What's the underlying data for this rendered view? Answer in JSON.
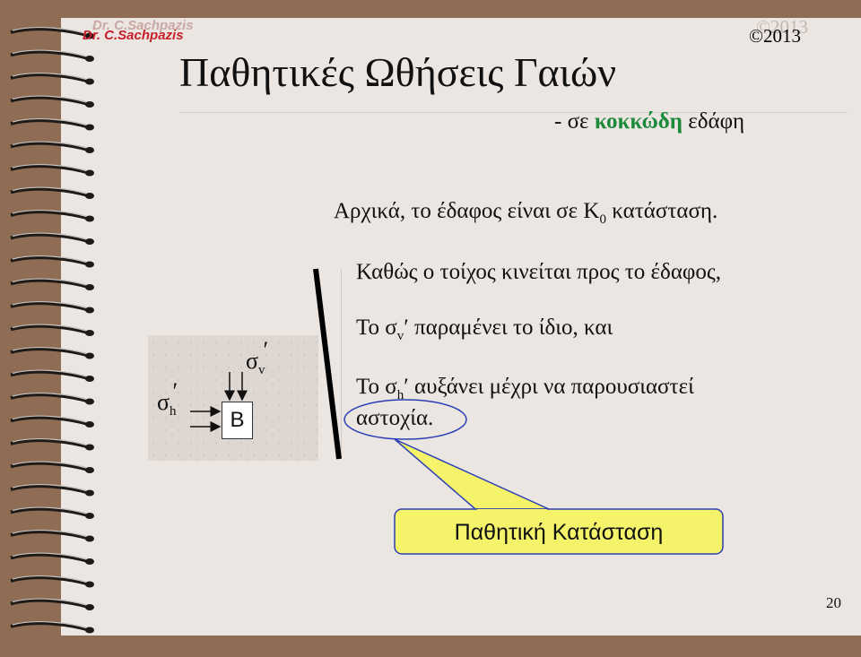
{
  "header": {
    "author": "Dr. C.Sachpazis",
    "copyright": "©2013",
    "title": "Παθητικές Ωθήσεις Γαιών",
    "subtitle_prefix": "- σε ",
    "subtitle_highlight": "κοκκώδη",
    "subtitle_suffix": " εδάφη"
  },
  "body": {
    "line1_prefix": "Αρχικά, το έδαφος είναι σε K",
    "line1_sub": "0",
    "line1_suffix": " κατάσταση.",
    "line2": "Καθώς ο τοίχος κινείται προς το έδαφος,",
    "line3_prefix": "Το σ",
    "line3_sub": "v",
    "line3_suffix": "′ παραμένει το ίδιο, και",
    "line4_prefix": "Το σ",
    "line4_sub": "h",
    "line4_suffix": "′ αυξάνει μέχρι να παρουσιαστεί",
    "line5": "αστοχία."
  },
  "diagram": {
    "sigma_h": "σ",
    "sigma_h_sub": "h",
    "sigma_v": "σ",
    "sigma_v_sub": "v",
    "prime": "′",
    "box_label": "B"
  },
  "callout": {
    "text": "Παθητική Κατάσταση",
    "border_color": "#2a3fb5"
  },
  "page_number": "20"
}
